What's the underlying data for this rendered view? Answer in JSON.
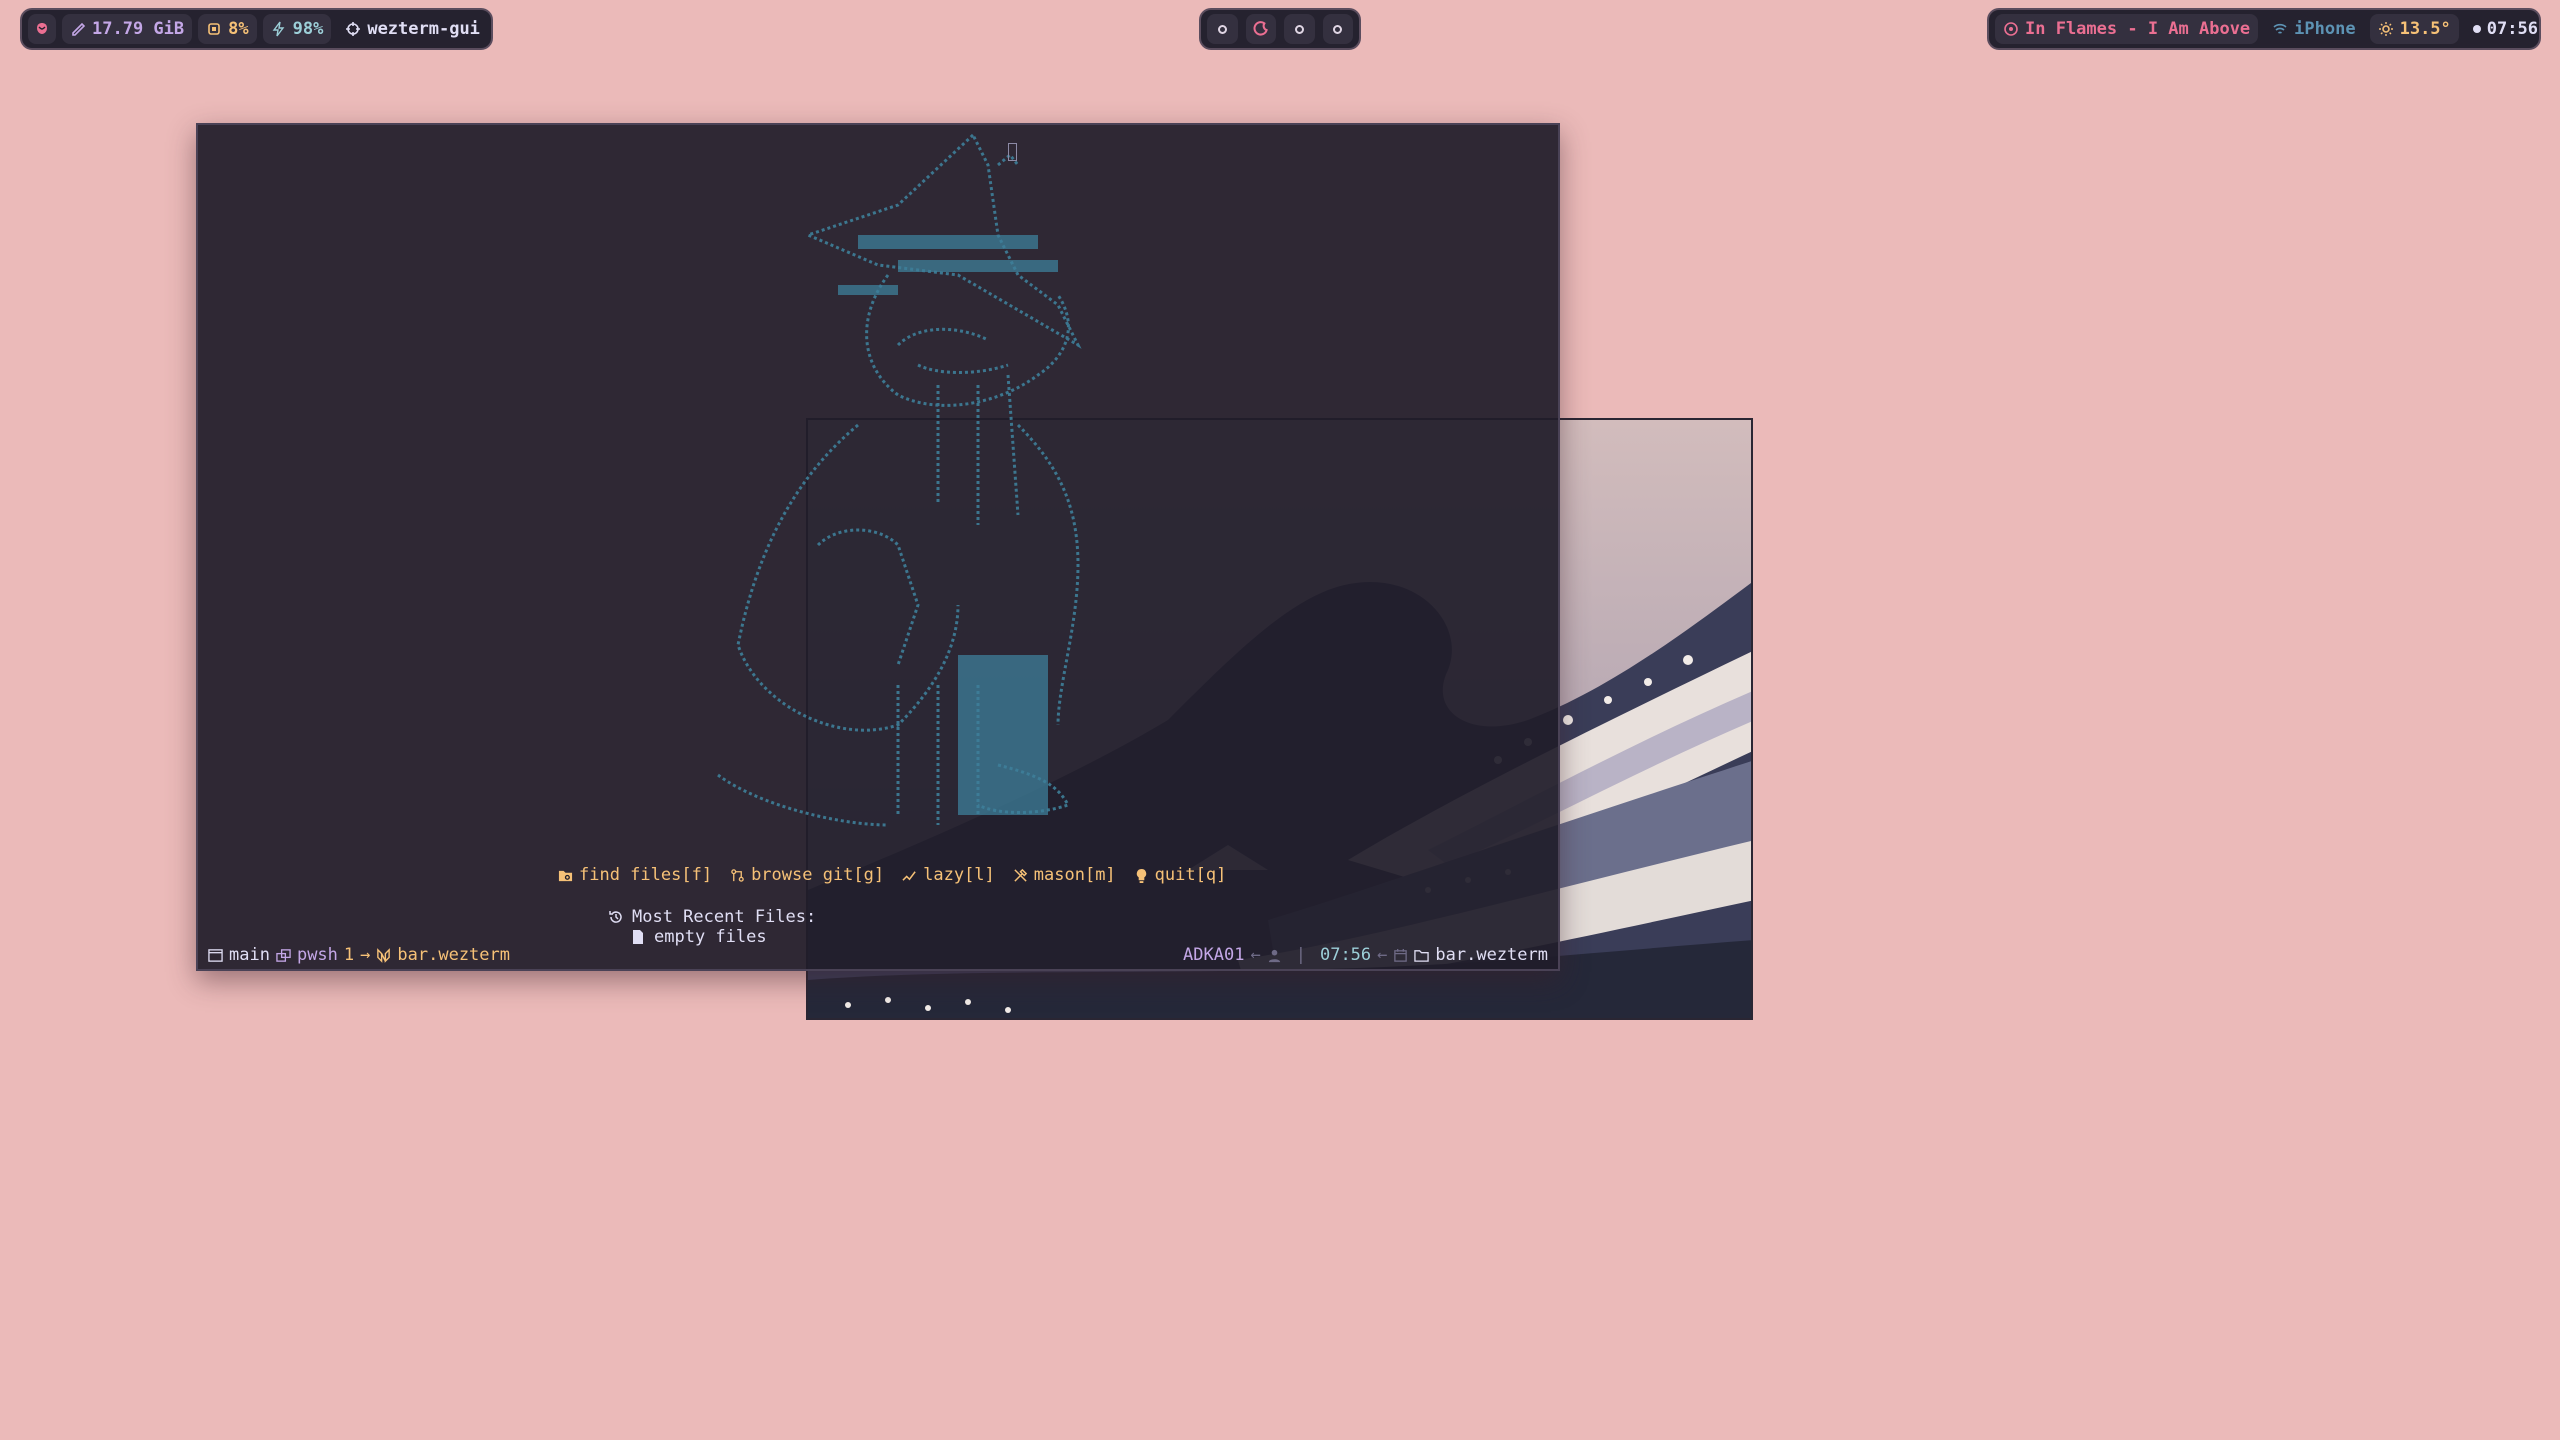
{
  "topbar": {
    "left": {
      "memory": "17.79 GiB",
      "cpu": "8%",
      "battery": "98%",
      "active_window": "wezterm-gui"
    },
    "right": {
      "music": "In Flames - I Am Above",
      "wifi": "iPhone",
      "weather": "13.5°",
      "clock": "07:56"
    }
  },
  "terminal": {
    "menu": [
      {
        "label": "find files[f]",
        "icon": "folder-search-icon"
      },
      {
        "label": "browse git[g]",
        "icon": "git-icon"
      },
      {
        "label": "lazy[l]",
        "icon": "lazy-icon"
      },
      {
        "label": "mason[m]",
        "icon": "tools-icon"
      },
      {
        "label": "quit[q]",
        "icon": "bulb-icon"
      }
    ],
    "recent_title": "Most Recent Files:",
    "recent_empty": "empty files",
    "status": {
      "workspace": "main",
      "shell": "pwsh",
      "tab_index": "1",
      "arrow": "→",
      "title": "bar.wezterm",
      "host": "ADKA01",
      "time": "07:56",
      "cwd": "bar.wezterm",
      "separator": "|"
    }
  },
  "colors": {
    "accent_pink": "#eb6f92",
    "accent_gold": "#f6c177",
    "accent_iris": "#c4a7e7",
    "accent_foam": "#9ccfd8",
    "accent_pine": "#5d93b4"
  }
}
